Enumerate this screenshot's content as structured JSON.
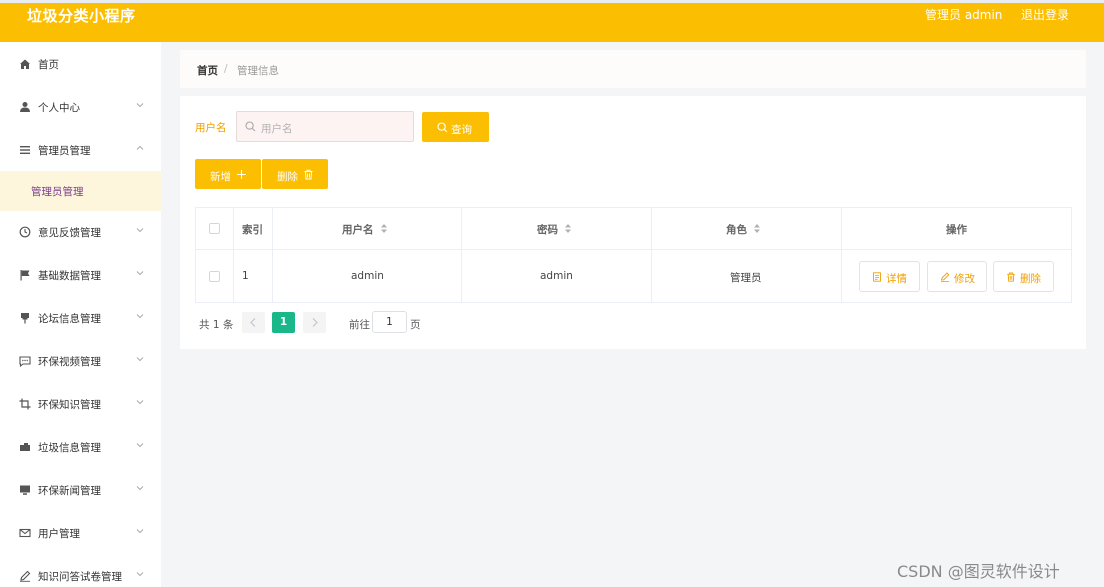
{
  "header": {
    "title": "垃圾分类小程序",
    "user_label": "管理员 admin",
    "logout_label": "退出登录"
  },
  "sidebar": {
    "items": [
      {
        "label": "首页",
        "icon": "home-icon",
        "has_chevron": false
      },
      {
        "label": "个人中心",
        "icon": "person-icon",
        "has_chevron": true
      },
      {
        "label": "管理员管理",
        "icon": "list-icon",
        "has_chevron": true,
        "expanded": true
      },
      {
        "label": "管理员管理",
        "icon": "",
        "has_chevron": false,
        "active": true
      },
      {
        "label": "意见反馈管理",
        "icon": "clock-icon",
        "has_chevron": true
      },
      {
        "label": "基础数据管理",
        "icon": "flag-icon",
        "has_chevron": true
      },
      {
        "label": "论坛信息管理",
        "icon": "pin-icon",
        "has_chevron": true
      },
      {
        "label": "环保视频管理",
        "icon": "chat-icon",
        "has_chevron": true
      },
      {
        "label": "环保知识管理",
        "icon": "crop-icon",
        "has_chevron": true
      },
      {
        "label": "垃圾信息管理",
        "icon": "truck-icon",
        "has_chevron": true
      },
      {
        "label": "环保新闻管理",
        "icon": "monitor-icon",
        "has_chevron": true
      },
      {
        "label": "用户管理",
        "icon": "mail-icon",
        "has_chevron": true
      },
      {
        "label": "知识问答试卷管理",
        "icon": "pencil-icon",
        "has_chevron": true
      }
    ]
  },
  "breadcrumb": {
    "home": "首页",
    "separator": "/",
    "current": "管理信息"
  },
  "search": {
    "label": "用户名",
    "placeholder": "用户名",
    "button_label": "查询"
  },
  "actions": {
    "add_label": "新增",
    "delete_label": "删除"
  },
  "table": {
    "columns": [
      "",
      "索引",
      "用户名",
      "密码",
      "角色",
      "操作"
    ],
    "rows": [
      {
        "index": "1",
        "username": "admin",
        "password": "admin",
        "role": "管理员"
      }
    ],
    "row_actions": [
      "详情",
      "修改",
      "删除"
    ]
  },
  "pagination": {
    "total": "共 1 条",
    "current_page": "1",
    "goto_label": "前往",
    "goto_value": "1",
    "page_suffix": "页"
  },
  "watermark": "CSDN @图灵软件设计",
  "colors": {
    "accent": "#fbbe00",
    "accent_text": "#f0a000",
    "page_active": "#19b78a",
    "submenu_active_bg": "#fef6dc",
    "submenu_active_text": "#7b3d8e"
  }
}
